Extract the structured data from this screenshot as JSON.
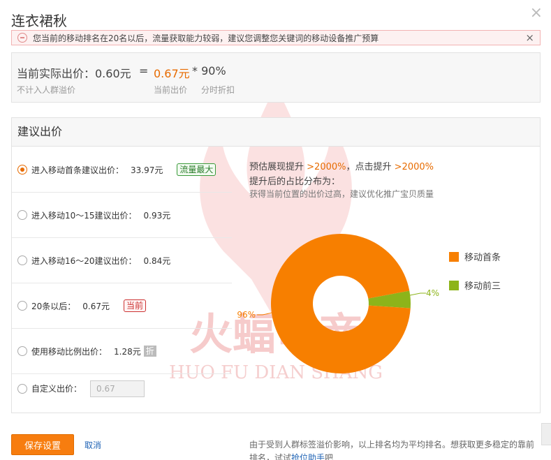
{
  "title": "连衣裙秋",
  "warning": {
    "text": "您当前的移动排名在20名以后，流量获取能力较弱，建议您调整您关键词的移动设备推广预算",
    "close": "×"
  },
  "close_icon": "×",
  "price": {
    "label": "当前实际出价：0.60元",
    "equals": "=",
    "current_bid": "0.67元",
    "times": "* 90%",
    "note_left": "不计入人群溢价",
    "note_bid": "当前出价",
    "note_discount": "分时折扣"
  },
  "suggest": {
    "heading": "建议出价",
    "options": [
      {
        "label": "进入移动首条建议出价：",
        "value": "33.97元",
        "badge": "流量最大",
        "checked": true
      },
      {
        "label": "进入移动10～15建议出价：",
        "value": "0.93元"
      },
      {
        "label": "进入移动16～20建议出价：",
        "value": "0.84元"
      },
      {
        "label": "20条以后：",
        "value": "0.67元",
        "badge": "当前"
      },
      {
        "label": "使用移动比例出价：",
        "value": "1.28元",
        "tag": "折"
      },
      {
        "label": "自定义出价：",
        "input_value": "0.67"
      }
    ],
    "estimate": {
      "prefix1": "预估展现提升",
      "val1": ">2000%",
      "prefix2": "，点击提升",
      "val2": ">2000%",
      "line2": "提升后的占比分布为：",
      "line3": "获得当前位置的出价过高，建议优化推广宝贝质量"
    }
  },
  "chart_data": {
    "type": "pie",
    "donut": true,
    "categories": [
      "移动首条",
      "移动前三"
    ],
    "values": [
      96,
      4
    ],
    "data_labels": [
      "96%",
      "4%"
    ],
    "colors": [
      "#f77f00",
      "#8db41a"
    ],
    "legend_position": "right"
  },
  "footer": {
    "save": "保存设置",
    "cancel": "取消",
    "note_prefix": "由于受到人群标签溢价影响，以上排名均为平均排名。想获取更多稳定的靠前排名，试试",
    "note_link": "抢位助手",
    "note_suffix": "吧"
  },
  "watermark": {
    "text_cn": "火蝠电商",
    "text_en": "HUO FU DIAN SHANG"
  },
  "colors": {
    "accent": "#f77d0f",
    "orange_text": "#e76b00",
    "link": "#1f63b5"
  }
}
